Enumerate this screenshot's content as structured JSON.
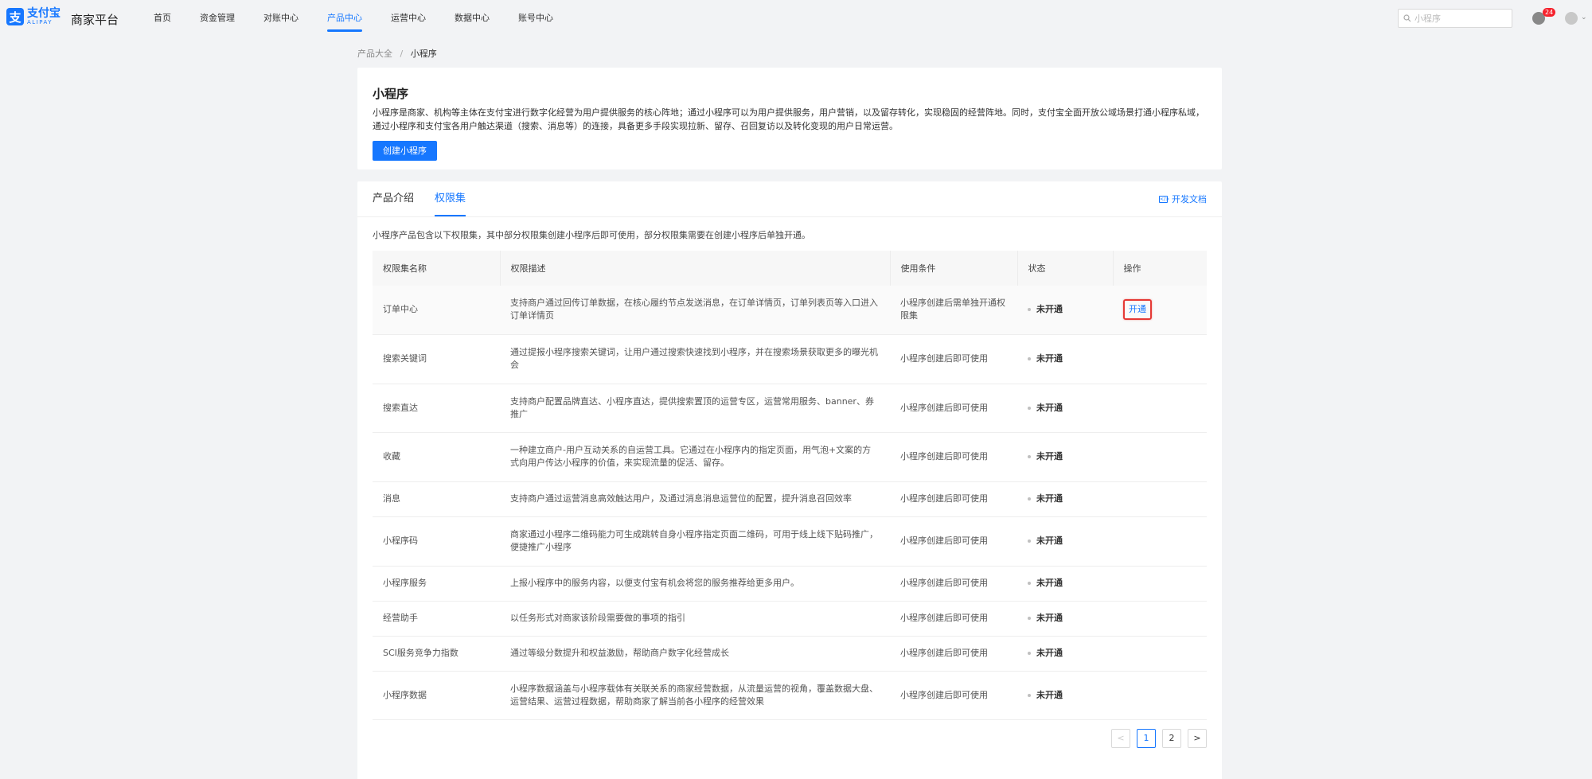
{
  "header": {
    "logo_zh": "支付宝",
    "logo_en": "ALIPAY",
    "platform_title": "商家平台",
    "nav": [
      {
        "label": "首页"
      },
      {
        "label": "资金管理"
      },
      {
        "label": "对账中心"
      },
      {
        "label": "产品中心",
        "active": true
      },
      {
        "label": "运营中心"
      },
      {
        "label": "数据中心"
      },
      {
        "label": "账号中心"
      }
    ],
    "search_placeholder": "小程序",
    "notification_count": "24",
    "accent_color": "#1677ff"
  },
  "breadcrumb": {
    "parent": "产品大全",
    "separator": "/",
    "current": "小程序"
  },
  "intro": {
    "title": "小程序",
    "description": "小程序是商家、机构等主体在支付宝进行数字化经营为用户提供服务的核心阵地；通过小程序可以为用户提供服务，用户营销，以及留存转化，实现稳固的经营阵地。同时，支付宝全面开放公域场景打通小程序私域，通过小程序和支付宝各用户触达渠道（搜索、消息等）的连接，具备更多手段实现拉新、留存、召回复访以及转化变现的用户日常运营。",
    "create_button": "创建小程序"
  },
  "tabs": {
    "items": [
      {
        "label": "产品介绍"
      },
      {
        "label": "权限集",
        "active": true
      }
    ],
    "docs_link": "开发文档",
    "description": "小程序产品包含以下权限集，其中部分权限集创建小程序后即可使用，部分权限集需要在创建小程序后单独开通。"
  },
  "table": {
    "headers": [
      "权限集名称",
      "权限描述",
      "使用条件",
      "状态",
      "操作"
    ],
    "rows": [
      {
        "name": "订单中心",
        "desc": "支持商户通过回传订单数据，在核心履约节点发送消息，在订单详情页，订单列表页等入口进入订单详情页",
        "condition": "小程序创建后需单独开通权限集",
        "status": "未开通",
        "action": "开通"
      },
      {
        "name": "搜索关键词",
        "desc": "通过提报小程序搜索关键词，让用户通过搜索快速找到小程序，并在搜索场景获取更多的曝光机会",
        "condition": "小程序创建后即可使用",
        "status": "未开通",
        "action": ""
      },
      {
        "name": "搜索直达",
        "desc": "支持商户配置品牌直达、小程序直达，提供搜索置顶的运营专区，运营常用服务、banner、券推广",
        "condition": "小程序创建后即可使用",
        "status": "未开通",
        "action": ""
      },
      {
        "name": "收藏",
        "desc": "一种建立商户-用户互动关系的自运营工具。它通过在小程序内的指定页面，用气泡+文案的方式向用户传达小程序的价值，来实现流量的促活、留存。",
        "condition": "小程序创建后即可使用",
        "status": "未开通",
        "action": ""
      },
      {
        "name": "消息",
        "desc": "支持商户通过运营消息高效触达用户，及通过消息消息运营位的配置，提升消息召回效率",
        "condition": "小程序创建后即可使用",
        "status": "未开通",
        "action": ""
      },
      {
        "name": "小程序码",
        "desc": "商家通过小程序二维码能力可生成跳转自身小程序指定页面二维码，可用于线上线下贴码推广，便捷推广小程序",
        "condition": "小程序创建后即可使用",
        "status": "未开通",
        "action": ""
      },
      {
        "name": "小程序服务",
        "desc": "上报小程序中的服务内容，以便支付宝有机会将您的服务推荐给更多用户。",
        "condition": "小程序创建后即可使用",
        "status": "未开通",
        "action": ""
      },
      {
        "name": "经营助手",
        "desc": "以任务形式对商家该阶段需要做的事项的指引",
        "condition": "小程序创建后即可使用",
        "status": "未开通",
        "action": ""
      },
      {
        "name": "SCI服务竞争力指数",
        "desc": "通过等级分数提升和权益激励，帮助商户数字化经营成长",
        "condition": "小程序创建后即可使用",
        "status": "未开通",
        "action": ""
      },
      {
        "name": "小程序数据",
        "desc": "小程序数据涵盖与小程序载体有关联关系的商家经营数据，从流量运营的视角，覆盖数据大盘、运营结果、运营过程数据，帮助商家了解当前各小程序的经营效果",
        "condition": "小程序创建后即可使用",
        "status": "未开通",
        "action": ""
      }
    ]
  },
  "pagination": {
    "prev": "<",
    "pages": [
      "1",
      "2"
    ],
    "current": "1",
    "next": ">"
  }
}
